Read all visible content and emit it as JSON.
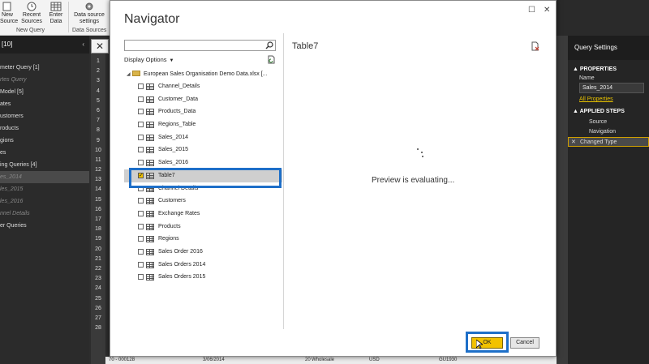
{
  "ribbon": {
    "new_source_label": "New\nSource",
    "recent_sources_label": "Recent\nSources",
    "enter_data_label": "Enter\nData",
    "data_source_settings_label": "Data source\nsettings",
    "group_new_query": "New Query",
    "group_data_sources": "Data Sources"
  },
  "left_panel": {
    "header": "[10]",
    "items": [
      {
        "label": "meter Query [1]",
        "style": "normal"
      },
      {
        "label": "rtes Query",
        "style": "dim"
      },
      {
        "label": "Model [5]",
        "style": "normal"
      },
      {
        "label": "ates",
        "style": "normal"
      },
      {
        "label": "ustomers",
        "style": "normal"
      },
      {
        "label": "roducts",
        "style": "normal"
      },
      {
        "label": "gions",
        "style": "normal"
      },
      {
        "label": "es",
        "style": "normal"
      },
      {
        "label": "ing Queries [4]",
        "style": "normal"
      },
      {
        "label": "es_2014",
        "style": "sel"
      },
      {
        "label": "les_2015",
        "style": "dim"
      },
      {
        "label": "les_2016",
        "style": "dim"
      },
      {
        "label": "nnel Details",
        "style": "dim"
      },
      {
        "label": "er Queries",
        "style": "normal"
      }
    ]
  },
  "row_numbers": [
    "1",
    "2",
    "3",
    "4",
    "5",
    "6",
    "7",
    "8",
    "9",
    "10",
    "11",
    "12",
    "13",
    "14",
    "15",
    "16",
    "17",
    "18",
    "19",
    "20",
    "21",
    "22",
    "23",
    "24",
    "25",
    "26",
    "27",
    "28"
  ],
  "bottom_row": {
    "id": "70 - 000128",
    "date": "3/06/2014",
    "qty": "20",
    "channel": "Wholesale",
    "currency": "USD",
    "code": "GU1930"
  },
  "right_panel": {
    "title": "Query Settings",
    "properties_header": "PROPERTIES",
    "name_label": "Name",
    "name_value": "Sales_2014",
    "all_properties_link": "All Properties",
    "applied_steps_header": "APPLIED STEPS",
    "steps": [
      {
        "label": "Source",
        "selected": false
      },
      {
        "label": "Navigation",
        "selected": false
      },
      {
        "label": "Changed Type",
        "selected": true
      }
    ]
  },
  "navigator": {
    "title": "Navigator",
    "search_placeholder": "",
    "display_options_label": "Display Options",
    "root_label": "European Sales Organisation Demo Data.xlsx [...",
    "items": [
      {
        "label": "Channel_Details",
        "kind": "table",
        "checked": false
      },
      {
        "label": "Customer_Data",
        "kind": "table",
        "checked": false
      },
      {
        "label": "Products_Data",
        "kind": "table",
        "checked": false
      },
      {
        "label": "Regions_Table",
        "kind": "table",
        "checked": false
      },
      {
        "label": "Sales_2014",
        "kind": "table",
        "checked": false
      },
      {
        "label": "Sales_2015",
        "kind": "table",
        "checked": false
      },
      {
        "label": "Sales_2016",
        "kind": "table",
        "checked": false
      },
      {
        "label": "Table7",
        "kind": "table",
        "checked": true
      },
      {
        "label": "Channel Details",
        "kind": "sheet",
        "checked": false
      },
      {
        "label": "Customers",
        "kind": "sheet",
        "checked": false
      },
      {
        "label": "Exchange Rates",
        "kind": "sheet",
        "checked": false
      },
      {
        "label": "Products",
        "kind": "sheet",
        "checked": false
      },
      {
        "label": "Regions",
        "kind": "sheet",
        "checked": false
      },
      {
        "label": "Sales Order 2016",
        "kind": "sheet",
        "checked": false
      },
      {
        "label": "Sales Orders 2014",
        "kind": "sheet",
        "checked": false
      },
      {
        "label": "Sales Orders 2015",
        "kind": "sheet",
        "checked": false
      }
    ],
    "preview_title": "Table7",
    "preview_status": "Preview is evaluating...",
    "ok_label": "OK",
    "cancel_label": "Cancel"
  },
  "colors": {
    "accent": "#f2c200",
    "highlight_frame": "#1e6fc8"
  }
}
